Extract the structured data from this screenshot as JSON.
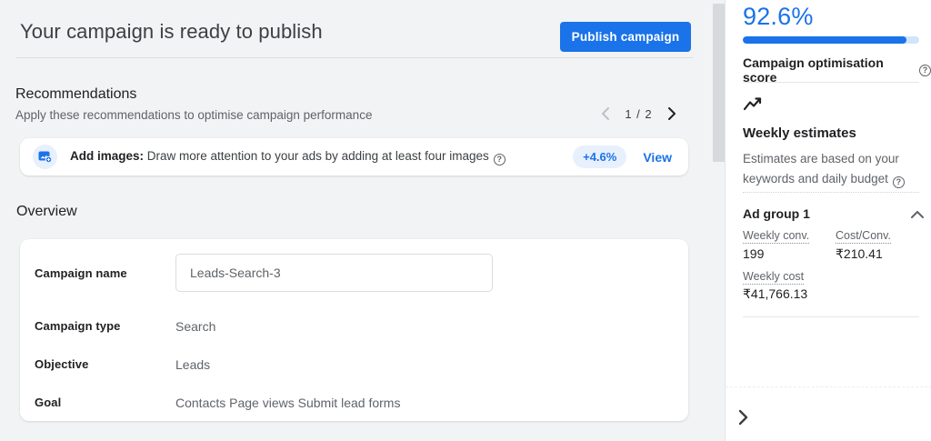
{
  "header": {
    "title": "Your campaign is ready to publish",
    "publish_label": "Publish campaign"
  },
  "recommendations": {
    "heading": "Recommendations",
    "subtitle": "Apply these recommendations to optimise campaign performance",
    "pagination": {
      "label": "1 / 2"
    },
    "card": {
      "icon": "add-image-icon",
      "title": "Add images:",
      "description": " Draw more attention to your ads by adding at least four images",
      "uplift": "+4.6%",
      "action": "View"
    }
  },
  "overview": {
    "heading": "Overview",
    "fields": [
      {
        "label": "Campaign name",
        "value": "Leads-Search-3"
      },
      {
        "label": "Campaign type",
        "value": "Search"
      },
      {
        "label": "Objective",
        "value": "Leads"
      },
      {
        "label": "Goal",
        "value": "Contacts Page views Submit lead forms"
      }
    ]
  },
  "sidebar": {
    "score": "92.6%",
    "score_percent": 92.6,
    "score_label": "Campaign optimisation score",
    "weekly": {
      "heading": "Weekly estimates",
      "subtitle": "Estimates are based on your keywords and daily budget"
    },
    "ad_group": {
      "name": "Ad group 1",
      "metrics": [
        {
          "label": "Weekly conv.",
          "value": "199"
        },
        {
          "label": "Cost/Conv.",
          "value": "₹210.41"
        },
        {
          "label": "Weekly cost",
          "value": "₹41,766.13"
        }
      ]
    }
  },
  "colors": {
    "accent": "#1a73e8",
    "pill_bg": "#e8f0fe",
    "track_blue": "#d2e3fc"
  }
}
